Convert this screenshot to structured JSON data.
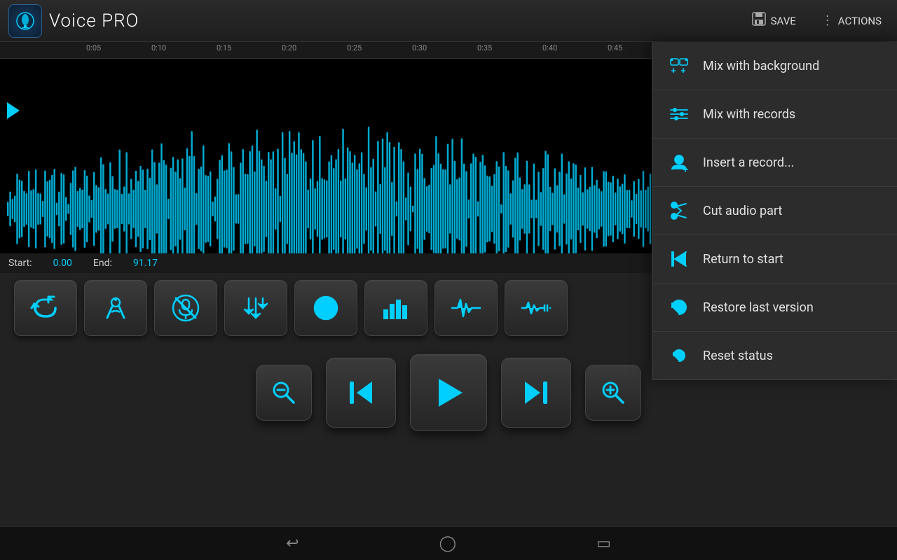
{
  "header": {
    "title": "Voice PRO",
    "save_label": "SAVE",
    "actions_label": "ACTIONS",
    "logo_text": "VOICE"
  },
  "waveform": {
    "start_label": "Start:",
    "start_value": "0.00",
    "end_label": "End:",
    "end_value": "91.17"
  },
  "timeline": {
    "marks": [
      "0:05",
      "0:10",
      "0:15",
      "0:20",
      "0:25",
      "0:30",
      "0:35",
      "0:40",
      "0:45"
    ]
  },
  "context_menu": {
    "items": [
      {
        "id": "mix-bg",
        "label": "Mix with background"
      },
      {
        "id": "mix-rec",
        "label": "Mix with records"
      },
      {
        "id": "insert-rec",
        "label": "Insert a record..."
      },
      {
        "id": "cut-audio",
        "label": "Cut audio part"
      },
      {
        "id": "return-start",
        "label": "Return to start"
      },
      {
        "id": "restore",
        "label": "Restore last version"
      },
      {
        "id": "reset",
        "label": "Reset status"
      }
    ]
  },
  "effects": [
    {
      "id": "undo",
      "label": "Undo"
    },
    {
      "id": "trim-noise",
      "label": "Trim noise"
    },
    {
      "id": "no-mic",
      "label": "No mic"
    },
    {
      "id": "noise-reduce",
      "label": "Noise reduce"
    },
    {
      "id": "eq",
      "label": "Equalizer"
    },
    {
      "id": "blocks",
      "label": "Blocks"
    },
    {
      "id": "waveform-fx",
      "label": "Waveform FX"
    },
    {
      "id": "envelope",
      "label": "Envelope"
    }
  ],
  "playback": {
    "zoom_out_label": "Zoom out",
    "skip_back_label": "Skip back",
    "play_label": "Play",
    "skip_forward_label": "Skip forward",
    "zoom_in_label": "Zoom in"
  },
  "nav": {
    "back_label": "Back",
    "home_label": "Home",
    "recent_label": "Recent"
  }
}
